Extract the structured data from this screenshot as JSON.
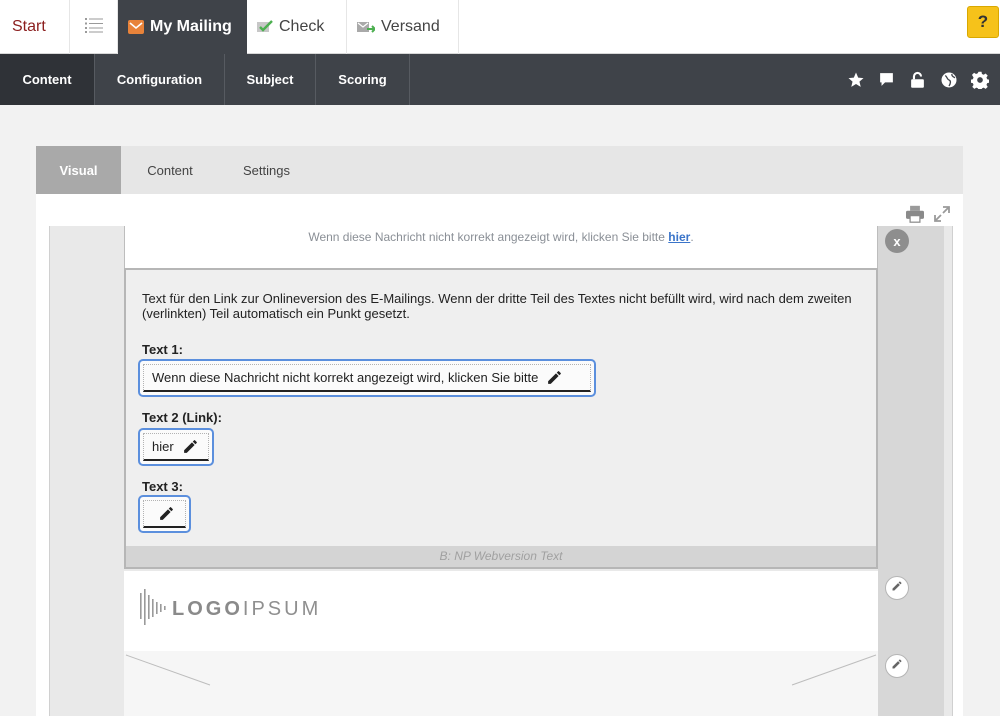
{
  "topbar": {
    "start_label": "Start",
    "mymailing_label": "My Mailing",
    "check_label": "Check",
    "versand_label": "Versand",
    "help_label": "?"
  },
  "subnav": {
    "tabs": [
      "Content",
      "Configuration",
      "Subject",
      "Scoring"
    ],
    "icons": [
      "star-icon",
      "comment-icon",
      "unlock-icon",
      "globe-icon",
      "gear-icon"
    ]
  },
  "card": {
    "tabs": [
      "Visual",
      "Content",
      "Settings"
    ]
  },
  "webversion": {
    "text": "Wenn diese Nachricht nicht korrekt angezeigt wird, klicken Sie bitte",
    "link": "hier",
    "suffix": "."
  },
  "close_label": "x",
  "editor": {
    "description": "Text für den Link zur Onlineversion des E-Mailings. Wenn der dritte Teil des Textes nicht befüllt wird, wird nach dem zweiten (verlinkten) Teil automatisch ein Punkt gesetzt.",
    "fields": [
      {
        "label": "Text 1:",
        "value": "Wenn diese Nachricht nicht korrekt angezeigt wird, klicken Sie bitte"
      },
      {
        "label": "Text 2 (Link):",
        "value": "hier"
      },
      {
        "label": "Text 3:",
        "value": ""
      }
    ],
    "footer": "B: NP Webversion Text"
  },
  "logo": {
    "bold": "LOGO",
    "light": "IPSUM"
  },
  "colors": {
    "dark_nav": "#3f4349",
    "accent_blue": "#5b8fdd",
    "brand_orange": "#e8833a",
    "help_yellow": "#f6c21a"
  }
}
